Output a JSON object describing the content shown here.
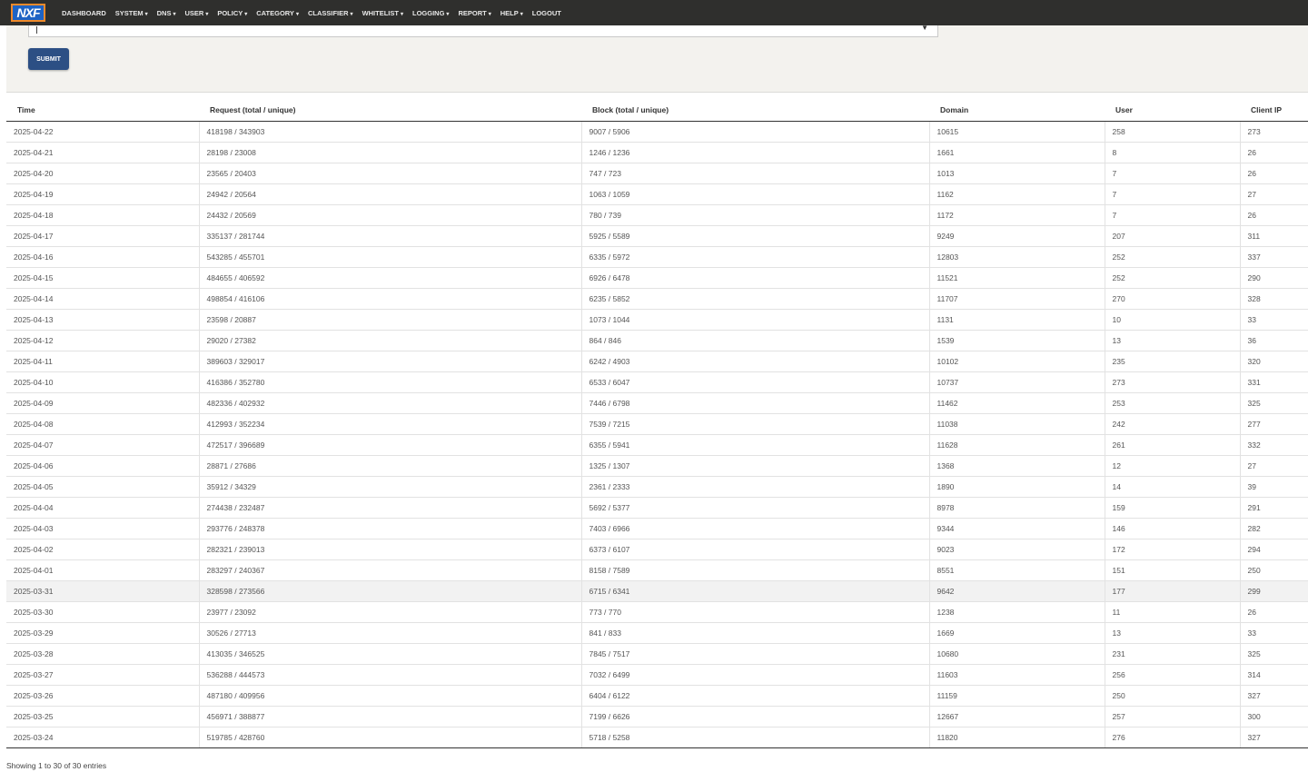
{
  "app": {
    "logo_text": "NXF"
  },
  "nav": [
    {
      "label": "DASHBOARD",
      "caret": ""
    },
    {
      "label": "SYSTEM",
      "caret": "▾"
    },
    {
      "label": "DNS",
      "caret": "▾"
    },
    {
      "label": "USER",
      "caret": "▾"
    },
    {
      "label": "POLICY",
      "caret": "▾"
    },
    {
      "label": "CATEGORY",
      "caret": "▾"
    },
    {
      "label": "CLASSIFIER",
      "caret": "▾"
    },
    {
      "label": "WHITELIST",
      "caret": "▾"
    },
    {
      "label": "LOGGING",
      "caret": "▾"
    },
    {
      "label": "REPORT",
      "caret": "▾"
    },
    {
      "label": "HELP",
      "caret": "▾"
    },
    {
      "label": "LOGOUT",
      "caret": ""
    }
  ],
  "filter": {
    "submit_label": "SUBMIT",
    "select_arrow": "▼"
  },
  "table": {
    "columns": [
      "Time",
      "Request (total / unique)",
      "Block (total / unique)",
      "Domain",
      "User",
      "Client IP"
    ],
    "rows": [
      [
        "2025-04-22",
        "418198 / 343903",
        "9007 / 5906",
        "10615",
        "258",
        "273"
      ],
      [
        "2025-04-21",
        "28198 / 23008",
        "1246 / 1236",
        "1661",
        "8",
        "26"
      ],
      [
        "2025-04-20",
        "23565 / 20403",
        "747 / 723",
        "1013",
        "7",
        "26"
      ],
      [
        "2025-04-19",
        "24942 / 20564",
        "1063 / 1059",
        "1162",
        "7",
        "27"
      ],
      [
        "2025-04-18",
        "24432 / 20569",
        "780 / 739",
        "1172",
        "7",
        "26"
      ],
      [
        "2025-04-17",
        "335137 / 281744",
        "5925 / 5589",
        "9249",
        "207",
        "311"
      ],
      [
        "2025-04-16",
        "543285 / 455701",
        "6335 / 5972",
        "12803",
        "252",
        "337"
      ],
      [
        "2025-04-15",
        "484655 / 406592",
        "6926 / 6478",
        "11521",
        "252",
        "290"
      ],
      [
        "2025-04-14",
        "498854 / 416106",
        "6235 / 5852",
        "11707",
        "270",
        "328"
      ],
      [
        "2025-04-13",
        "23598 / 20887",
        "1073 / 1044",
        "1131",
        "10",
        "33"
      ],
      [
        "2025-04-12",
        "29020 / 27382",
        "864 / 846",
        "1539",
        "13",
        "36"
      ],
      [
        "2025-04-11",
        "389603 / 329017",
        "6242 / 4903",
        "10102",
        "235",
        "320"
      ],
      [
        "2025-04-10",
        "416386 / 352780",
        "6533 / 6047",
        "10737",
        "273",
        "331"
      ],
      [
        "2025-04-09",
        "482336 / 402932",
        "7446 / 6798",
        "11462",
        "253",
        "325"
      ],
      [
        "2025-04-08",
        "412993 / 352234",
        "7539 / 7215",
        "11038",
        "242",
        "277"
      ],
      [
        "2025-04-07",
        "472517 / 396689",
        "6355 / 5941",
        "11628",
        "261",
        "332"
      ],
      [
        "2025-04-06",
        "28871 / 27686",
        "1325 / 1307",
        "1368",
        "12",
        "27"
      ],
      [
        "2025-04-05",
        "35912 / 34329",
        "2361 / 2333",
        "1890",
        "14",
        "39"
      ],
      [
        "2025-04-04",
        "274438 / 232487",
        "5692 / 5377",
        "8978",
        "159",
        "291"
      ],
      [
        "2025-04-03",
        "293776 / 248378",
        "7403 / 6966",
        "9344",
        "146",
        "282"
      ],
      [
        "2025-04-02",
        "282321 / 239013",
        "6373 / 6107",
        "9023",
        "172",
        "294"
      ],
      [
        "2025-04-01",
        "283297 / 240367",
        "8158 / 7589",
        "8551",
        "151",
        "250"
      ],
      [
        "2025-03-31",
        "328598 / 273566",
        "6715 / 6341",
        "9642",
        "177",
        "299"
      ],
      [
        "2025-03-30",
        "23977 / 23092",
        "773 / 770",
        "1238",
        "11",
        "26"
      ],
      [
        "2025-03-29",
        "30526 / 27713",
        "841 / 833",
        "1669",
        "13",
        "33"
      ],
      [
        "2025-03-28",
        "413035 / 346525",
        "7845 / 7517",
        "10680",
        "231",
        "325"
      ],
      [
        "2025-03-27",
        "536288 / 444573",
        "7032 / 6499",
        "11603",
        "256",
        "314"
      ],
      [
        "2025-03-26",
        "487180 / 409956",
        "6404 / 6122",
        "11159",
        "250",
        "327"
      ],
      [
        "2025-03-25",
        "456971 / 388877",
        "7199 / 6626",
        "12667",
        "257",
        "300"
      ],
      [
        "2025-03-24",
        "519785 / 428760",
        "5718 / 5258",
        "11820",
        "276",
        "327"
      ]
    ],
    "highlighted_row_index": 22
  },
  "footer": {
    "info": "Showing 1 to 30 of 30 entries"
  },
  "colors": {
    "topbar": "#2f2f2d",
    "submit": "#2c4f84",
    "logo_bg": "#1e63c4",
    "logo_border": "#f08a2b"
  }
}
